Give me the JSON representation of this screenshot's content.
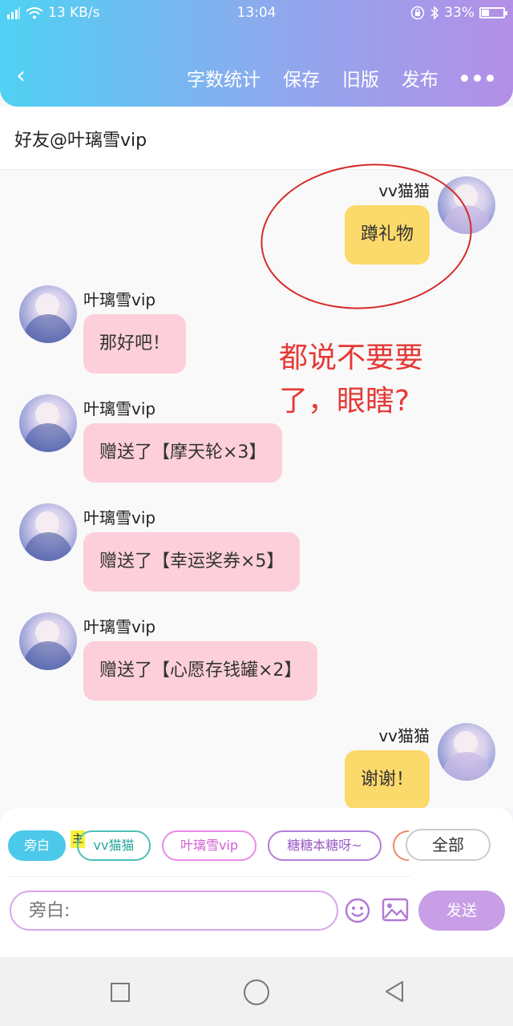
{
  "status_bar": {
    "network_speed": "13 KB/s",
    "time": "13:04",
    "battery_pct": "33%",
    "battery_level": 0.33
  },
  "header": {
    "back_icon": "‹",
    "actions": [
      "字数统计",
      "保存",
      "旧版",
      "发布"
    ],
    "more_icon": "more-dots"
  },
  "subheader": {
    "title": "好友@叶璃雪vip"
  },
  "messages": [
    {
      "sender": "vv猫猫",
      "text": "蹲礼物",
      "side": "right",
      "bubble_color": "#fbd96b"
    },
    {
      "sender": "叶璃雪vip",
      "text": "那好吧！",
      "side": "left",
      "bubble_color": "#fccfda"
    },
    {
      "sender": "叶璃雪vip",
      "text": "赠送了【摩天轮×3】",
      "side": "left",
      "bubble_color": "#fccfda"
    },
    {
      "sender": "叶璃雪vip",
      "text": "赠送了【幸运奖券×5】",
      "side": "left",
      "bubble_color": "#fccfda"
    },
    {
      "sender": "叶璃雪vip",
      "text": "赠送了【心愿存钱罐×2】",
      "side": "left",
      "bubble_color": "#fccfda"
    },
    {
      "sender": "vv猫猫",
      "text": "谢谢！",
      "side": "right",
      "bubble_color": "#fbd96b"
    }
  ],
  "annotation": {
    "line1": "都说不要要",
    "line2": "了，眼瞎?"
  },
  "chips": {
    "narration": "旁白",
    "main_badge": "主",
    "roles": [
      "vv猫猫",
      "叶璃雪vip",
      "糖糖本糖呀~"
    ],
    "all": "全部"
  },
  "composer": {
    "placeholder": "旁白:",
    "send": "发送"
  }
}
